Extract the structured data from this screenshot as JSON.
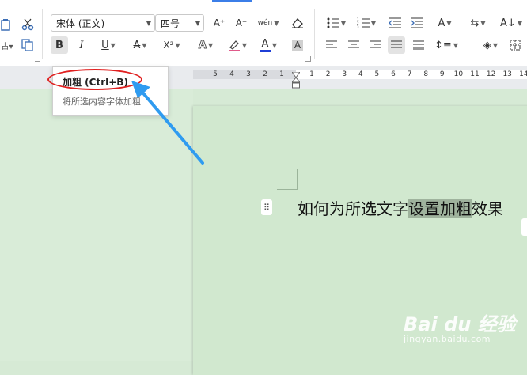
{
  "toolbar": {
    "font_name": "宋体 (正文)",
    "font_size": "四号",
    "bold_label": "B",
    "italic_label": "I",
    "underline_label": "U",
    "strike_label": "A",
    "superscript_label": "X²",
    "font_color_label": "A",
    "char_shading_label": "A",
    "grow_font_label": "A⁺",
    "shrink_font_label": "A⁻",
    "phonetic_label": "wén"
  },
  "tooltip": {
    "title": "加粗 (Ctrl+B)",
    "description": "将所选内容字体加粗"
  },
  "ruler": {
    "ticks": [
      "5",
      "4",
      "3",
      "2",
      "1",
      "1",
      "2",
      "3",
      "4",
      "5",
      "6",
      "7",
      "8",
      "9",
      "10",
      "11",
      "12",
      "13",
      "14"
    ]
  },
  "document": {
    "text_before": "如何为所选文字",
    "text_selected": "设置加粗",
    "text_after": "效果"
  },
  "watermark": {
    "logo": "Bai du 经验",
    "url": "jingyan.baidu.com"
  },
  "colors": {
    "accent": "#3b7ee8",
    "annotation_red": "#e02020",
    "annotation_arrow": "#2f9bf0",
    "page_bg": "#d1e8cf",
    "selection": "#9fb39d"
  }
}
